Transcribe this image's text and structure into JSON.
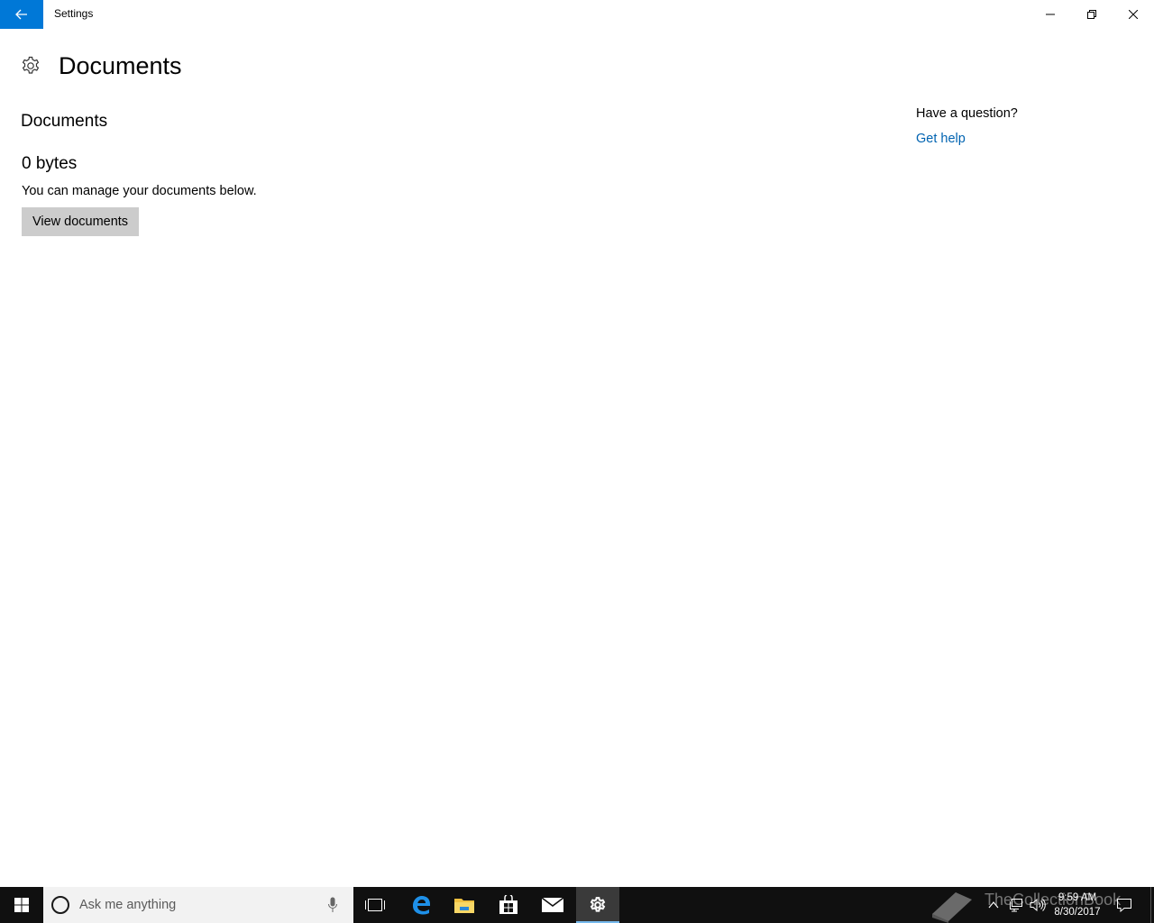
{
  "window": {
    "title": "Settings"
  },
  "page": {
    "title": "Documents"
  },
  "section": {
    "title": "Documents",
    "size": "0 bytes",
    "description": "You can manage your documents below.",
    "view_button": "View documents"
  },
  "help": {
    "question": "Have a question?",
    "link": "Get help"
  },
  "taskbar": {
    "search_placeholder": "Ask me anything",
    "pinned": [
      "task-view",
      "edge",
      "file-explorer",
      "store",
      "mail",
      "settings"
    ],
    "active": "settings"
  },
  "tray": {
    "time": "9:59 AM",
    "date": "8/30/2017",
    "watermark": "TheCollectionBook"
  },
  "colors": {
    "accent": "#0078d7",
    "link": "#0063b1",
    "button_bg": "#cccccc",
    "taskbar_bg": "#101010"
  }
}
